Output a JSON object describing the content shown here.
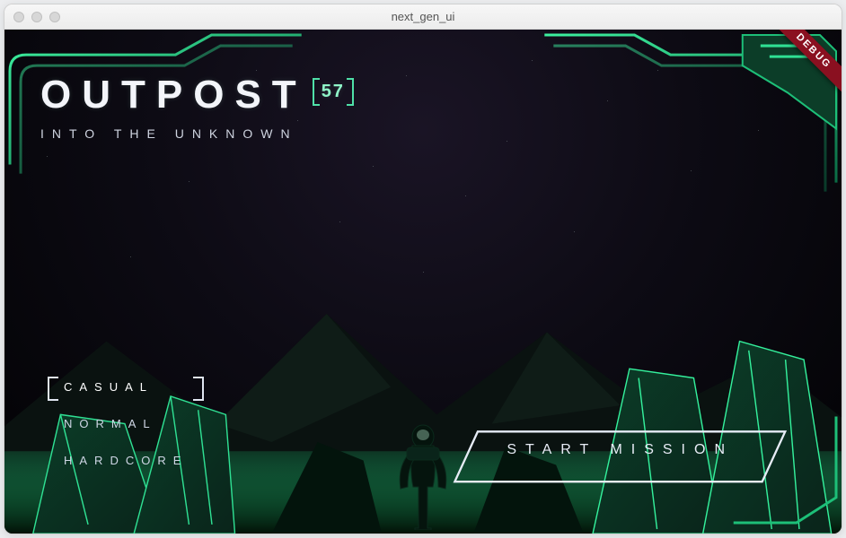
{
  "window": {
    "title": "next_gen_ui"
  },
  "game": {
    "title": "OUTPOST",
    "badge": "57",
    "subtitle": "INTO THE UNKNOWN",
    "difficulty": {
      "options": [
        "CASUAL",
        "NORMAL",
        "HARDCORE"
      ],
      "selected_index": 0
    },
    "start_label": "START MISSION",
    "ribbon": "DEBUG",
    "accent": "#38e29a",
    "accent_dark": "#0c6b44"
  }
}
